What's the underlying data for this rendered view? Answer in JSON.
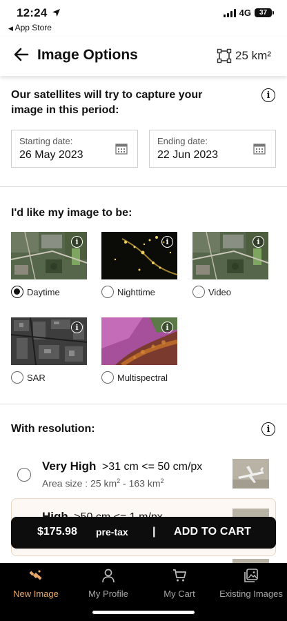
{
  "status_bar": {
    "time": "12:24",
    "back_app": "App Store",
    "network": "4G",
    "battery": "37"
  },
  "header": {
    "title": "Image Options",
    "area_value": "25",
    "area_unit": "km²"
  },
  "period": {
    "title_line1": "Our satellites will try to capture your",
    "title_line2": "image in this period:",
    "start_label": "Starting date:",
    "start_value": "26 May 2023",
    "end_label": "Ending date:",
    "end_value": "22 Jun 2023"
  },
  "image_type": {
    "title": "I'd like my image to be:",
    "options": [
      {
        "label": "Daytime",
        "selected": true,
        "icon": "daytime-thumbnail"
      },
      {
        "label": "Nighttime",
        "selected": false,
        "icon": "nighttime-thumbnail"
      },
      {
        "label": "Video",
        "selected": false,
        "icon": "video-thumbnail"
      },
      {
        "label": "SAR",
        "selected": false,
        "icon": "sar-thumbnail"
      },
      {
        "label": "Multispectral",
        "selected": false,
        "icon": "multispectral-thumbnail"
      }
    ]
  },
  "resolution": {
    "title": "With resolution:",
    "options": [
      {
        "title": "Very High",
        "range": ">31 cm <= 50 cm/px",
        "area_prefix": "Area size : 25  km",
        "area_mid": " - 163  km",
        "sup": "2",
        "selected": false
      },
      {
        "title": "High",
        "range": ">50 cm <= 1 m/px",
        "selected": false
      }
    ]
  },
  "cart": {
    "price": "$175.98",
    "pretax": "pre-tax",
    "separator": "|",
    "action": "ADD TO CART"
  },
  "tabs": [
    {
      "label": "New Image",
      "icon": "satellite-icon",
      "active": true
    },
    {
      "label": "My Profile",
      "icon": "profile-icon",
      "active": false
    },
    {
      "label": "My Cart",
      "icon": "cart-icon",
      "active": false
    },
    {
      "label": "Existing Images",
      "icon": "gallery-icon",
      "active": false
    }
  ],
  "colors": {
    "accent": "#e7a86a",
    "cart_bar": "#0d0d0d",
    "tabbar": "#000000",
    "highlight_card": "#fdf8f3"
  }
}
